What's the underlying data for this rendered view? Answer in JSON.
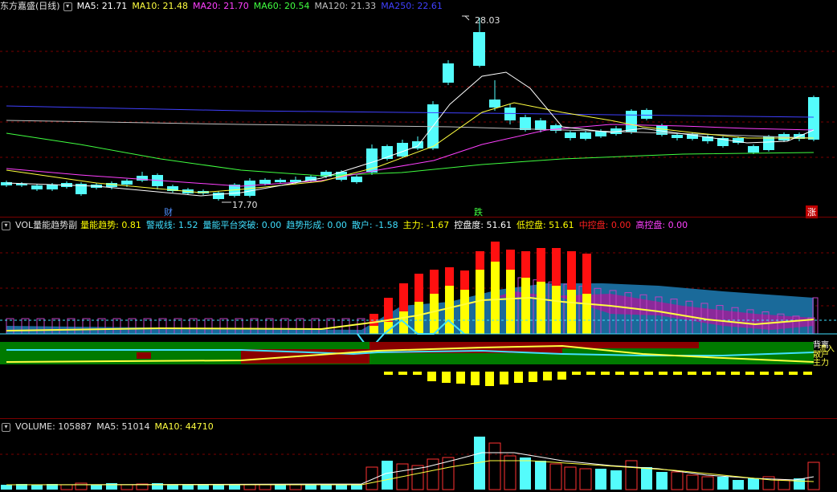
{
  "main": {
    "title": "东方嘉盛(日线)",
    "ma": [
      {
        "label": "MA5: 21.71",
        "color": "#ffffff"
      },
      {
        "label": "MA10: 21.48",
        "color": "#ffff40"
      },
      {
        "label": "MA20: 21.70",
        "color": "#ff40ff"
      },
      {
        "label": "MA60: 20.54",
        "color": "#40ff40"
      },
      {
        "label": "MA120: 21.33",
        "color": "#c0c0c0"
      },
      {
        "label": "MA250: 22.61",
        "color": "#4040ff"
      }
    ],
    "high_label": "28.03",
    "low_label": "17.70",
    "marks": {
      "cai": "财",
      "die": "跌",
      "zhang": "涨"
    }
  },
  "vol_ind": {
    "title": "VOL量能趋势副",
    "items": [
      {
        "label": "量能趋势: 0.81",
        "color": "#ffff00"
      },
      {
        "label": "警戒线: 1.52",
        "color": "#40e0ff"
      },
      {
        "label": "量能平台突破: 0.00",
        "color": "#40e0ff"
      },
      {
        "label": "趋势形成: 0.00",
        "color": "#40e0ff"
      },
      {
        "label": "散户: -1.58",
        "color": "#40e0ff"
      },
      {
        "label": "主力: -1.67",
        "color": "#ffff00"
      },
      {
        "label": "控盘度: 51.61",
        "color": "#ffffff"
      },
      {
        "label": "低控盘: 51.61",
        "color": "#ffff00"
      },
      {
        "label": "中控盘: 0.00",
        "color": "#ff2020"
      },
      {
        "label": "高控盘: 0.00",
        "color": "#ff40ff"
      }
    ],
    "side_labels": {
      "diverge": "背离",
      "inflow": "流入",
      "retail": "散户",
      "main": "主力"
    }
  },
  "volume": {
    "title": "VOLUME: 105887",
    "ma5": "MA5: 51014",
    "ma10": "MA10: 44710"
  },
  "colors": {
    "up": "#ff3232",
    "down": "#54fcfc",
    "bg": "#000000",
    "grid": "#7a0000"
  }
}
